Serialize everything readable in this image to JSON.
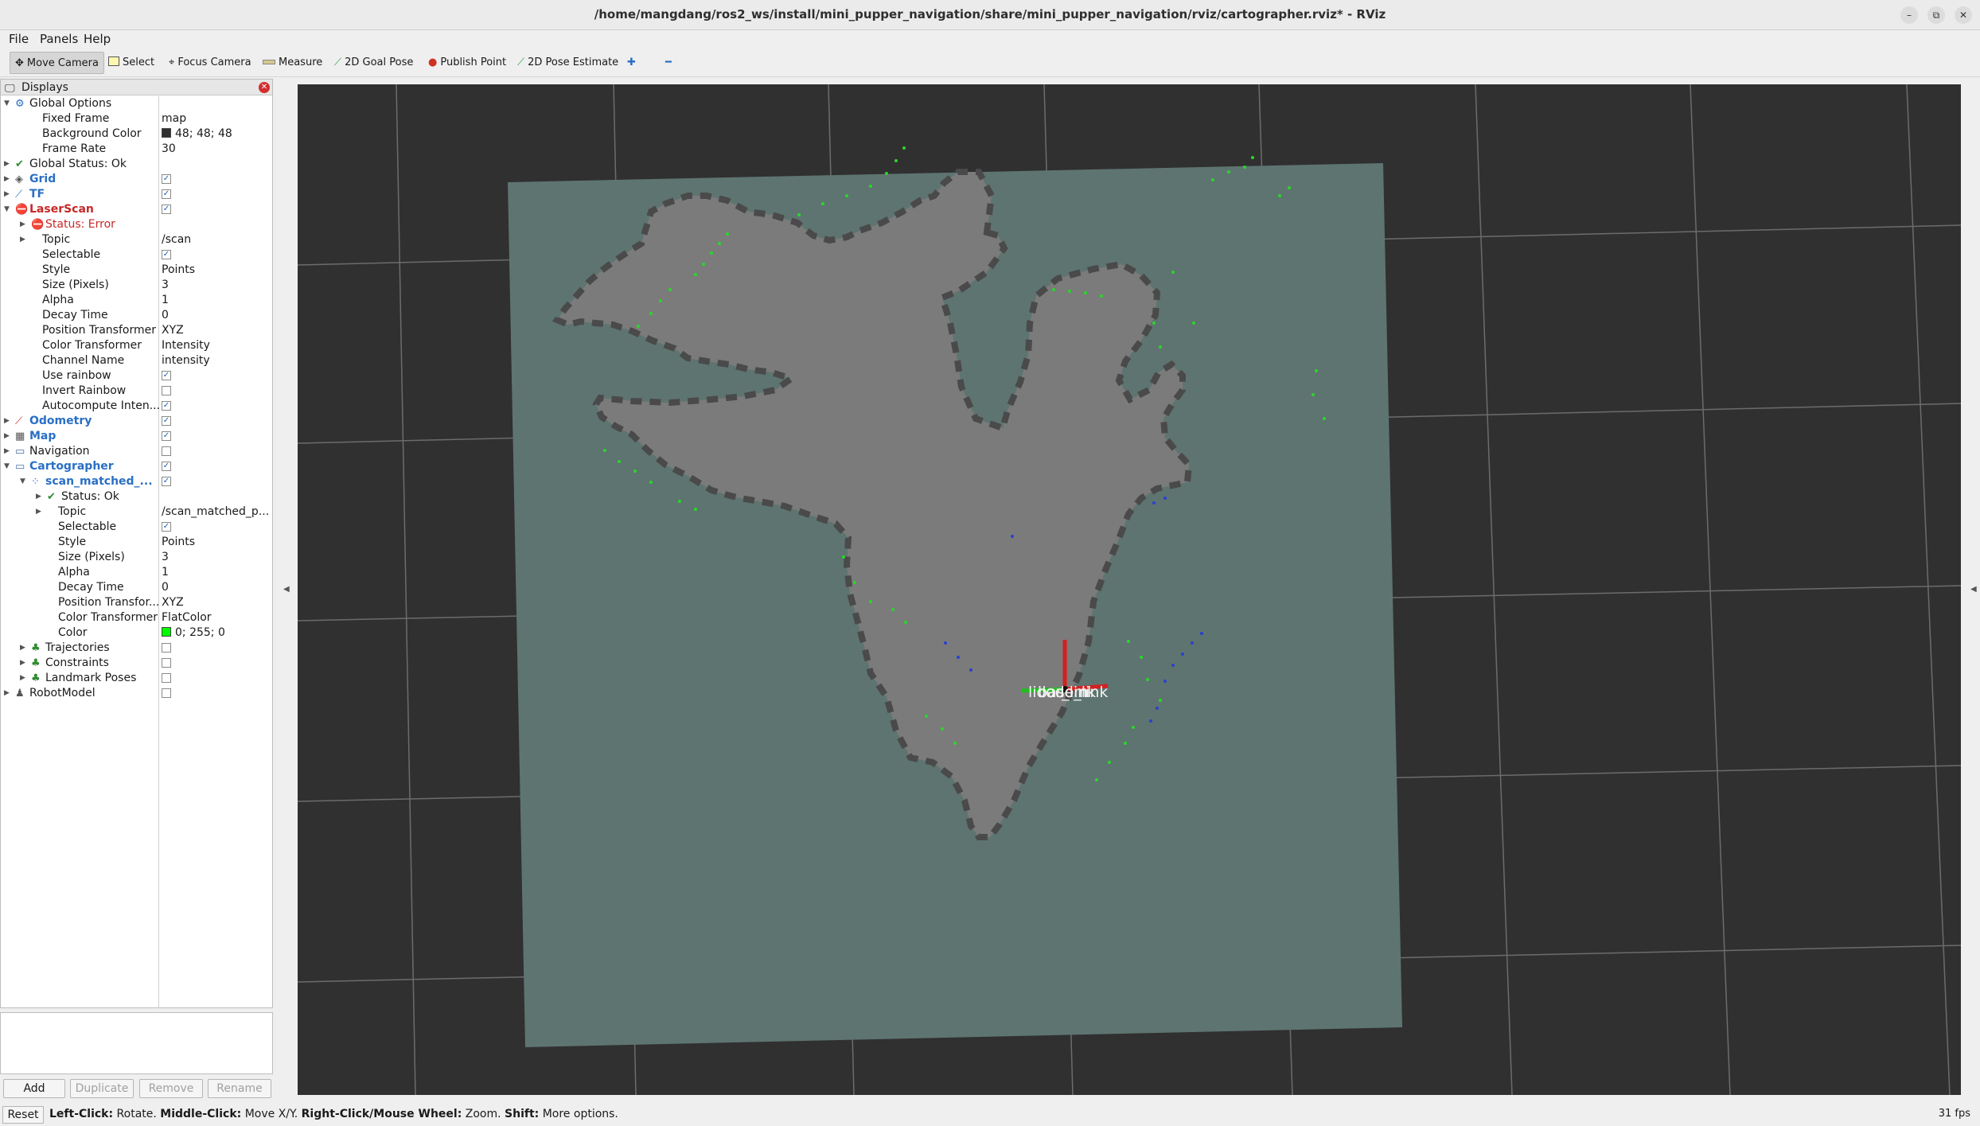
{
  "window": {
    "title": "/home/mangdang/ros2_ws/install/mini_pupper_navigation/share/mini_pupper_navigation/rviz/cartographer.rviz* - RViz",
    "controls": [
      "–",
      "⧉",
      "✕"
    ]
  },
  "menu": [
    "File",
    "Panels",
    "Help"
  ],
  "toolbar": {
    "tools": [
      "Move Camera",
      "Select",
      "Focus Camera",
      "Measure",
      "2D Goal Pose",
      "Publish Point",
      "2D Pose Estimate"
    ],
    "icons": [
      "move-camera-icon",
      "select-icon",
      "focus-camera-icon",
      "measure-icon",
      "goal-pose-icon",
      "publish-point-icon",
      "pose-estimate-icon",
      "add-tool-icon",
      "remove-tool-icon"
    ]
  },
  "displays": {
    "panel_title": "Displays",
    "rows": [
      {
        "label": "Global Options",
        "value": ""
      },
      {
        "label": "Fixed Frame",
        "value": "map"
      },
      {
        "label": "Background Color",
        "value": "48; 48; 48",
        "color": "#303030"
      },
      {
        "label": "Frame Rate",
        "value": "30"
      },
      {
        "label": "Global Status: Ok",
        "value": ""
      },
      {
        "label": "Grid",
        "checked": true
      },
      {
        "label": "TF",
        "checked": true
      },
      {
        "label": "LaserScan",
        "checked": true
      },
      {
        "label": "Status: Error",
        "value": ""
      },
      {
        "label": "Topic",
        "value": "/scan"
      },
      {
        "label": "Selectable",
        "checked": true
      },
      {
        "label": "Style",
        "value": "Points"
      },
      {
        "label": "Size (Pixels)",
        "value": "3"
      },
      {
        "label": "Alpha",
        "value": "1"
      },
      {
        "label": "Decay Time",
        "value": "0"
      },
      {
        "label": "Position Transformer",
        "value": "XYZ"
      },
      {
        "label": "Color Transformer",
        "value": "Intensity"
      },
      {
        "label": "Channel Name",
        "value": "intensity"
      },
      {
        "label": "Use rainbow",
        "checked": true
      },
      {
        "label": "Invert Rainbow",
        "checked": false
      },
      {
        "label": "Autocompute Inten...",
        "checked": true
      },
      {
        "label": "Odometry",
        "checked": true
      },
      {
        "label": "Map",
        "checked": true
      },
      {
        "label": "Navigation",
        "checked": false
      },
      {
        "label": "Cartographer",
        "checked": true
      },
      {
        "label": "scan_matched_...",
        "checked": true
      },
      {
        "label": "Status: Ok",
        "value": ""
      },
      {
        "label": "Topic",
        "value": "/scan_matched_p..."
      },
      {
        "label": "Selectable",
        "checked": true
      },
      {
        "label": "Style",
        "value": "Points"
      },
      {
        "label": "Size (Pixels)",
        "value": "3"
      },
      {
        "label": "Alpha",
        "value": "1"
      },
      {
        "label": "Decay Time",
        "value": "0"
      },
      {
        "label": "Position Transfor...",
        "value": "XYZ"
      },
      {
        "label": "Color Transformer",
        "value": "FlatColor"
      },
      {
        "label": "Color",
        "value": "0; 255; 0",
        "color": "#00ff00"
      },
      {
        "label": "Trajectories",
        "checked": false
      },
      {
        "label": "Constraints",
        "checked": false
      },
      {
        "label": "Landmark Poses",
        "checked": false
      },
      {
        "label": "RobotModel",
        "checked": false
      }
    ]
  },
  "buttons": {
    "add": "Add",
    "duplicate": "Duplicate",
    "remove": "Remove",
    "rename": "Rename"
  },
  "view3d": {
    "frame_labels": [
      "lidar_link",
      "odom",
      "base_link"
    ],
    "map_color": "#5e7470",
    "free_space_color": "#7a7a7a"
  },
  "status": {
    "reset": "Reset",
    "hint_parts": [
      {
        "b": "Left-Click:",
        "t": " Rotate. "
      },
      {
        "b": "Middle-Click:",
        "t": " Move X/Y. "
      },
      {
        "b": "Right-Click/Mouse Wheel:",
        "t": " Zoom. "
      },
      {
        "b": "Shift:",
        "t": " More options."
      }
    ],
    "fps": "31 fps"
  }
}
